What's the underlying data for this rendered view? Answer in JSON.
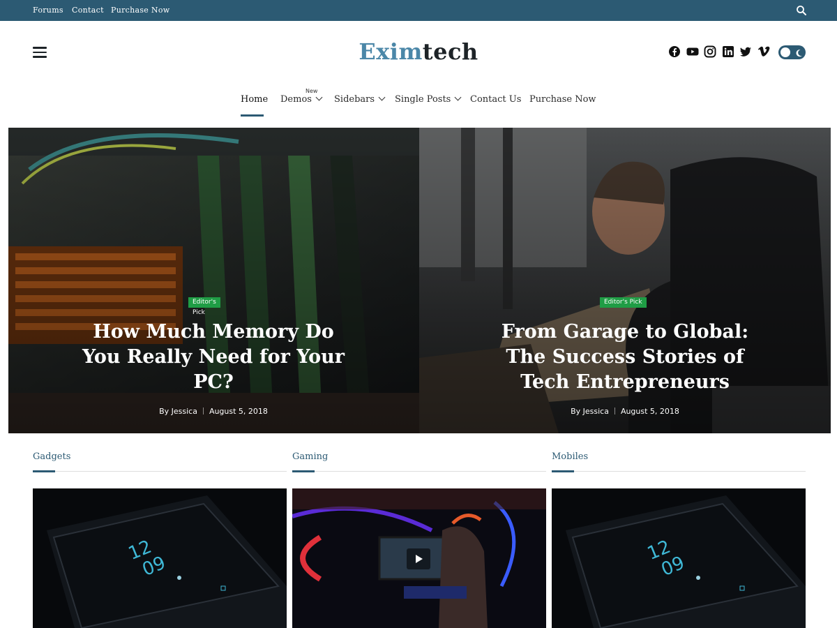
{
  "topbar": {
    "links": [
      "Forums",
      "Contact",
      "Purchase Now"
    ]
  },
  "header": {
    "logo_part1": "Exim",
    "logo_part2": "tech",
    "social_icons": [
      "facebook-icon",
      "youtube-icon",
      "instagram-icon",
      "linkedin-icon",
      "twitter-icon",
      "vimeo-icon"
    ]
  },
  "nav": {
    "items": [
      "Home",
      "Demos",
      "Sidebars",
      "Single Posts",
      "Contact Us",
      "Purchase Now"
    ],
    "new_badge": "New",
    "active_index": 0
  },
  "hero": {
    "posts": [
      {
        "badge": "Editor's Pick",
        "title": "How Much Memory Do You Really Need for Your PC?",
        "author": "By Jessica",
        "date": "August 5, 2018"
      },
      {
        "badge": "Editor's Pick",
        "title": "From Garage to Global: The Success Stories of Tech Entrepreneurs",
        "author": "By Jessica",
        "date": "August 5, 2018"
      }
    ]
  },
  "categories": [
    {
      "title": "Gadgets"
    },
    {
      "title": "Gaming"
    },
    {
      "title": "Mobiles"
    }
  ],
  "colors": {
    "brand": "#2c5a73",
    "logo_accent": "#4b87a8",
    "badge_green": "#1f9d45"
  }
}
